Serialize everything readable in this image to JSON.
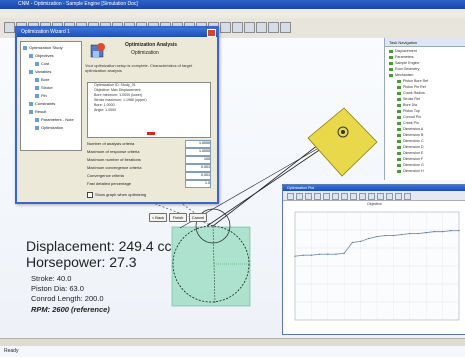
{
  "app": {
    "title": "CNM - Optimization - Sample Engine [Simulation Doc]"
  },
  "menu": [
    "File",
    "Edit",
    "View",
    "Insert",
    "Format",
    "Tools",
    "Simulation",
    "Window",
    "Preferences",
    "Display",
    "Help",
    "Optimization"
  ],
  "dialog": {
    "title": "Optimization Wizard 1",
    "header_title": "Optimization Analysis",
    "header_subtitle": "Optimization",
    "description": "Your optimization setup is complete. Characteristics of target optimization analysis",
    "tree": [
      "Optimization Study",
      "Objectives",
      "Cost",
      "Variables",
      "Bore",
      "Stroke",
      "Pin",
      "Constraints",
      "Result",
      "Parameters - Note",
      "Optimization"
    ],
    "params": [
      "Optimization ID:  Study_01",
      "   Objective:  Max Displacement",
      "   Bore minimum:  1.0000 (lower)",
      "   Stroke maximum:  1.1986 (upper)",
      "   Bore:  1.0000",
      "   Angle:  1.0000"
    ],
    "fields": [
      {
        "label": "Number of analysis criteria",
        "value": "1.0000"
      },
      {
        "label": "Maximum of response criteria",
        "value": "1.0000"
      },
      {
        "label": "Maximum number of iterations",
        "value": "100"
      },
      {
        "label": "Maximum convergence criteria",
        "value": "0.001"
      },
      {
        "label": "Convergence criteria",
        "value": "0.001"
      },
      {
        "label": "Fast detailed percentage",
        "value": "1.0"
      }
    ],
    "checkbox_label": "Show graph when optimizing",
    "buttons": [
      "< Back",
      "Finish",
      "Cancel"
    ]
  },
  "right_panel": {
    "title": "Task Navigation",
    "items": [
      "Displacement",
      "Parameters",
      "Sample Engine",
      "Root Geometry",
      "Mechanism",
      "Piston Bore Ref",
      "Piston Pin Ref",
      "Crank Radius",
      "Stroke Ref",
      "Bore Dia",
      "Piston Top",
      "Conrod Pin",
      "Crank Pin",
      "Dimension A",
      "Dimension B",
      "Dimension C",
      "Dimension D",
      "Dimension E",
      "Dimension F",
      "Dimension G",
      "Dimension H"
    ]
  },
  "readout": {
    "displacement": "Displacement: 249.4 cc",
    "horsepower": "Horsepower: 27.3",
    "stroke": "Stroke:       40.0",
    "piston_dia": "Piston Dia:     63.0",
    "conrod_length": "Conrod Length: 200.0",
    "rpm": "RPM: 2600 (reference)"
  },
  "plot_window": {
    "title": "Optimization Plot",
    "chart_title": "Objective"
  },
  "status": {
    "text": "Ready"
  },
  "chart_data": {
    "type": "line",
    "title": "Objective",
    "x": [
      0,
      1,
      2,
      3,
      4,
      5,
      6,
      7,
      8,
      9,
      10,
      11,
      12,
      13,
      14,
      15,
      16,
      17,
      18,
      19,
      20
    ],
    "series": [
      {
        "values": [
          215,
          216,
          216,
          217,
          217,
          217,
          218,
          229,
          230,
          233,
          235,
          236,
          236,
          237,
          238,
          238,
          239,
          240,
          240,
          241,
          241
        ]
      }
    ],
    "ylim": [
      150,
      260
    ],
    "grid": true
  },
  "colors": {
    "accent": "#1c4fb8",
    "cube": "#e8d84a",
    "selection_box": "#7fd6b0"
  }
}
